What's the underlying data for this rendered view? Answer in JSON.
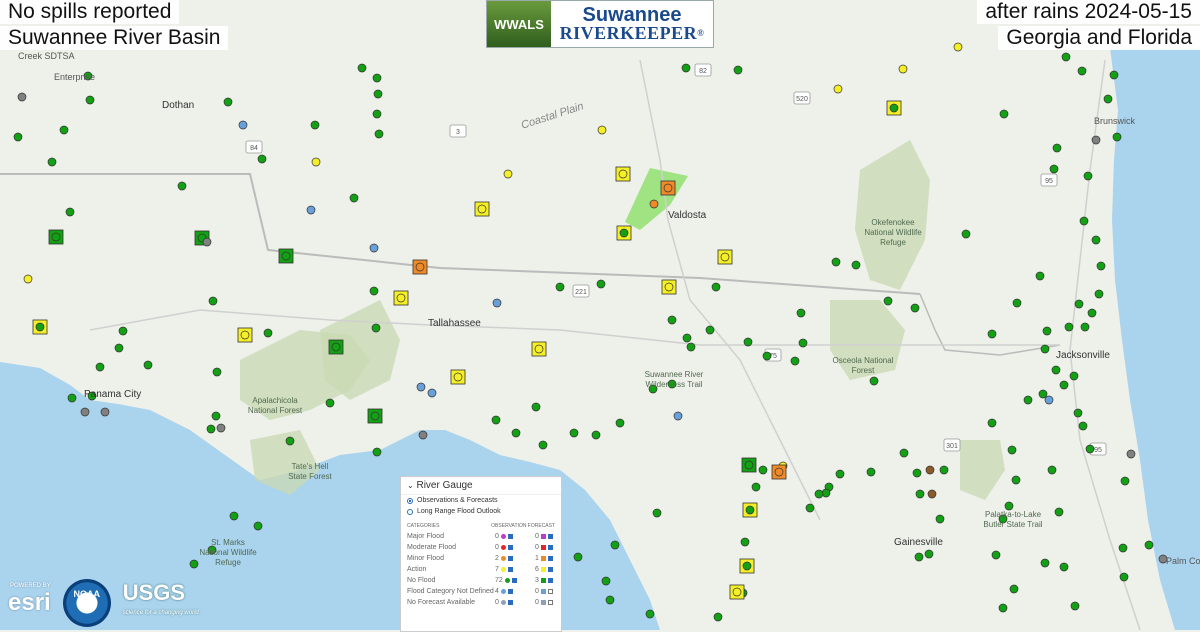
{
  "header": {
    "top_left": "No spills reported",
    "bottom_left": "Suwannee River Basin",
    "top_right": "after rains 2024-05-15",
    "bottom_right": "Georgia and Florida"
  },
  "logo": {
    "badge": "WWALS",
    "line1": "Suwannee",
    "line2": "RIVERKEEPER",
    "registered": "®"
  },
  "map_labels": {
    "creek_sdtsa": "Creek SDTSA",
    "enterprise": "Enterprise",
    "dothan": "Dothan",
    "coastal_plain": "Coastal Plain",
    "valdosta": "Valdosta",
    "okefenokee": "Okefenokee National Wildlife Refuge",
    "tallahassee": "Tallahassee",
    "panama_city": "Panama City",
    "apalachicola": "Apalachicola National Forest",
    "suwannee_trail": "Suwannee River Wilderness Trail",
    "osceola": "Osceola National Forest",
    "jacksonville": "Jacksonville",
    "tates_hell": "Tate's Hell State Forest",
    "st_marks": "St. Marks National Wildlife Refuge",
    "gainesville": "Gainesville",
    "palatka": "Palatka-to-Lake Butler State Trail",
    "brunswick": "Brunswick",
    "palm_coast": "Palm Coast",
    "route_82": "82",
    "route_520": "520",
    "route_84": "84",
    "route_3": "3",
    "route_221": "221",
    "route_75": "75",
    "route_95a": "95",
    "route_95b": "95",
    "route_301": "301"
  },
  "legend": {
    "title": "River Gauge",
    "option_observations": "Observations & Forecasts",
    "option_long_range": "Long Range Flood Outlook",
    "col_categories": "CATEGORIES",
    "col_observation": "OBSERVATION",
    "col_forecast": "FORECAST",
    "rows": [
      {
        "name": "Major Flood",
        "obs": "0",
        "fc": "0",
        "color": "#c03ad0"
      },
      {
        "name": "Moderate Flood",
        "obs": "0",
        "fc": "0",
        "color": "#e0282a"
      },
      {
        "name": "Minor Flood",
        "obs": "2",
        "fc": "1",
        "color": "#f08a28"
      },
      {
        "name": "Action",
        "obs": "7",
        "fc": "6",
        "color": "#f5ef28"
      },
      {
        "name": "No Flood",
        "obs": "72",
        "fc": "3",
        "color": "#14a014"
      },
      {
        "name": "Flood Category Not Defined",
        "obs": "4",
        "fc": "0",
        "color": "#6aa0d8"
      },
      {
        "name": "No Forecast Available",
        "obs": "0",
        "fc": "0",
        "color": "#8fa0b8"
      }
    ]
  },
  "credits": {
    "esri_small": "POWERED BY",
    "esri": "esri",
    "noaa": "NOAA",
    "usgs": "USGS",
    "usgs_tag": "science for a changing world"
  },
  "colors": {
    "no_flood": "#14a014",
    "action": "#f5ef28",
    "minor_flood": "#f08a28",
    "not_defined": "#6aa0d8",
    "no_data": "#808080",
    "brown": "#8a5a2b",
    "water": "#aad3ee",
    "land": "#eef0ea",
    "forest": "#c9d9b4"
  }
}
